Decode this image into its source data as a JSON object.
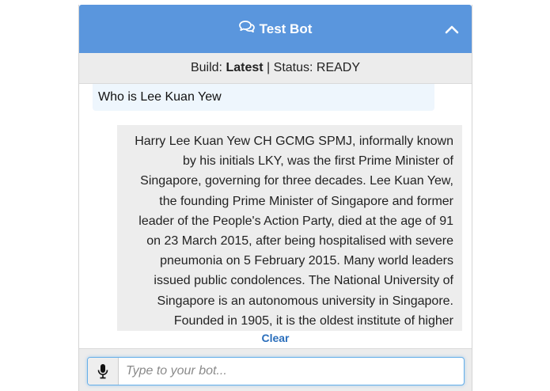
{
  "header": {
    "title": "Test Bot",
    "icon": "chat-bubbles-icon",
    "collapse_icon": "chevron-up-icon",
    "color": "#5a96dd"
  },
  "status": {
    "build_label": "Build:",
    "build_value": "Latest",
    "separator": "|",
    "status_text": "Status: READY"
  },
  "conversation": {
    "user_message": "Who is Lee Kuan Yew",
    "bot_lines": [
      "Harry Lee Kuan Yew CH GCMG SPMJ, informally known",
      "by his initials LKY, was the first Prime Minister of",
      "Singapore, governing for three decades. Lee Kuan Yew,",
      "the founding Prime Minister of Singapore and former",
      "leader of the People's Action Party, died at the age of 91",
      "on 23 March 2015, after being hospitalised with severe",
      "pneumonia on 5 February 2015. Many world leaders",
      "issued public condolences. The National University of",
      "Singapore is an autonomous university in Singapore.",
      "Founded in 1905, it is the oldest institute of higher"
    ]
  },
  "actions": {
    "clear_label": "Clear"
  },
  "input": {
    "placeholder": "Type to your bot...",
    "value": "",
    "mic_icon": "microphone-icon"
  }
}
